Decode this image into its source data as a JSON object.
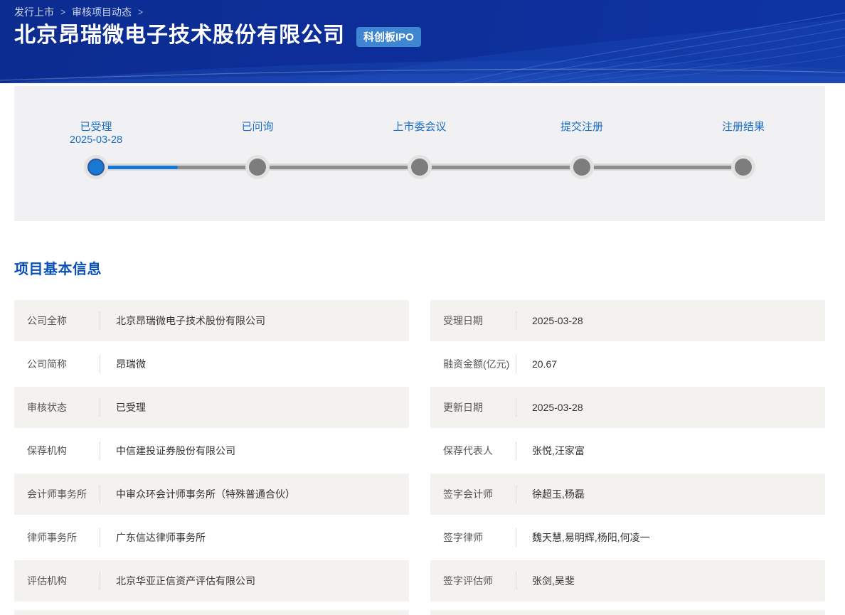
{
  "header": {
    "breadcrumb": {
      "items": [
        "发行上市",
        "审核项目动态"
      ],
      "separator": ">"
    },
    "title": "北京昂瑞微电子技术股份有限公司",
    "badge": "科创板IPO"
  },
  "stepper": {
    "steps": [
      {
        "label": "已受理",
        "date": "2025-03-28",
        "state": "active"
      },
      {
        "label": "已问询",
        "state": "pending"
      },
      {
        "label": "上市委会议",
        "state": "pending"
      },
      {
        "label": "提交注册",
        "state": "pending"
      },
      {
        "label": "注册结果",
        "state": "pending"
      }
    ]
  },
  "section": {
    "title": "项目基本信息"
  },
  "info": {
    "left_rows": [
      {
        "label": "公司全称",
        "value": "北京昂瑞微电子技术股份有限公司"
      },
      {
        "label": "公司简称",
        "value": "昂瑞微"
      },
      {
        "label": "审核状态",
        "value": "已受理"
      },
      {
        "label": "保荐机构",
        "value": "中信建投证券股份有限公司"
      },
      {
        "label": "会计师事务所",
        "value": "中审众环会计师事务所（特殊普通合伙）"
      },
      {
        "label": "律师事务所",
        "value": "广东信达律师事务所"
      },
      {
        "label": "评估机构",
        "value": "北京华亚正信资产评估有限公司"
      }
    ],
    "right_rows": [
      {
        "label": "受理日期",
        "value": "2025-03-28"
      },
      {
        "label": "融资金额(亿元)",
        "value": "20.67"
      },
      {
        "label": "更新日期",
        "value": "2025-03-28"
      },
      {
        "label": "保荐代表人",
        "value": "张悦,汪家富"
      },
      {
        "label": "签字会计师",
        "value": "徐超玉,杨磊"
      },
      {
        "label": "签字律师",
        "value": "魏天慧,易明辉,杨阳,何凌一"
      },
      {
        "label": "签字评估师",
        "value": "张剑,吴斐"
      }
    ]
  },
  "colors": {
    "header_bg": "#0c2d93",
    "badge_bg": "#3e86d1",
    "accent_blue": "#1879d2",
    "step_label_blue": "#1b6ec5",
    "panel_bg": "#f1f1f3",
    "row_bg": "#f4f2ef",
    "heading_blue": "#0b51b7",
    "label_text": "#555555",
    "value_text": "#333333",
    "inactive_dot": "#7d7d7d"
  }
}
